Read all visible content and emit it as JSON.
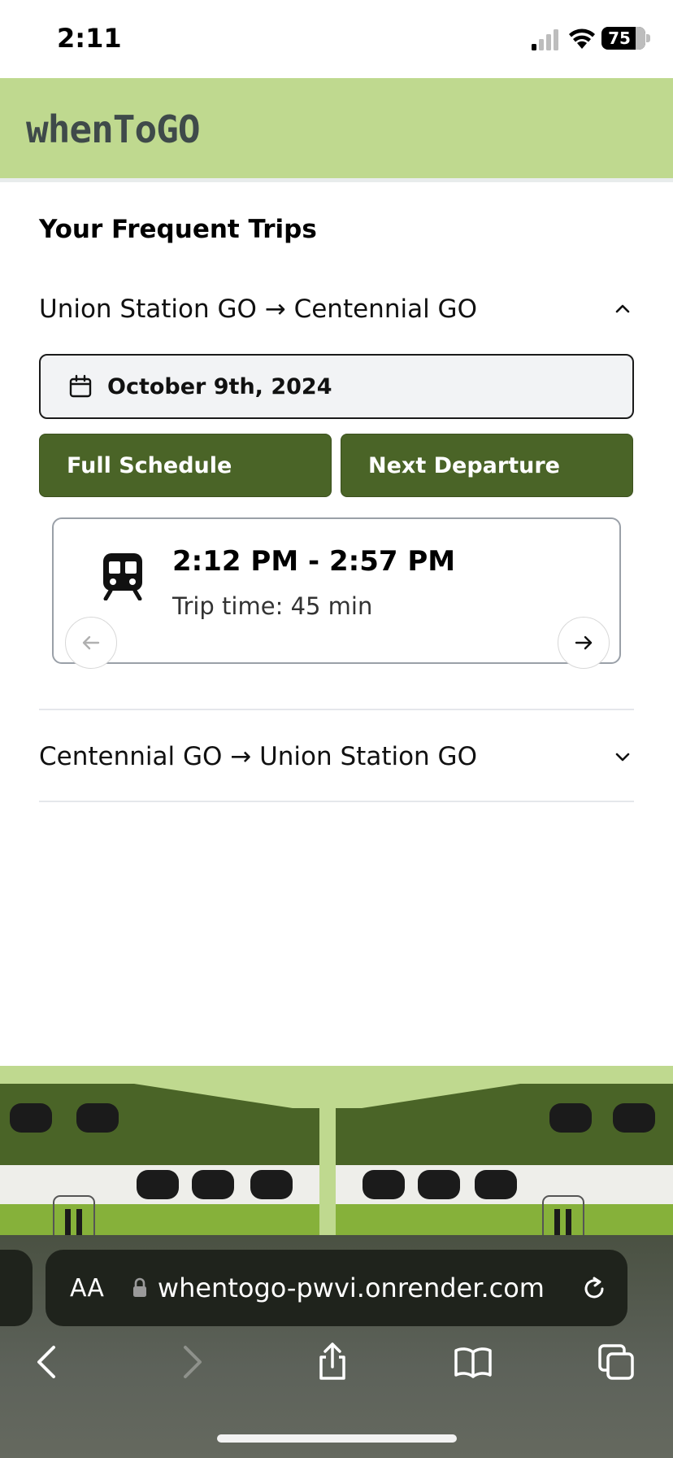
{
  "status_bar": {
    "time": "2:11",
    "battery": "75"
  },
  "app": {
    "logo": "whenToGO"
  },
  "section_title": "Your Frequent Trips",
  "trips": [
    {
      "route": "Union Station GO → Centennial GO",
      "expanded": true,
      "date": "October 9th, 2024",
      "full_schedule_label": "Full Schedule",
      "next_departure_label": "Next Departure",
      "departure": {
        "time_range": "2:12 PM - 2:57 PM",
        "trip_time": "Trip time: 45 min"
      }
    },
    {
      "route": "Centennial GO → Union Station GO",
      "expanded": false
    }
  ],
  "browser": {
    "aa_label": "AA",
    "url": "whentogo-pwvi.onrender.com"
  },
  "colors": {
    "header": "#bfd98f",
    "button": "#4a6427",
    "train_dark": "#4a6427",
    "train_light": "#8cb43a"
  },
  "icons": [
    "calendar-icon",
    "train-icon",
    "arrow-left-icon",
    "arrow-right-icon",
    "chevron-up-icon",
    "chevron-down-icon",
    "lock-icon",
    "reload-icon"
  ]
}
